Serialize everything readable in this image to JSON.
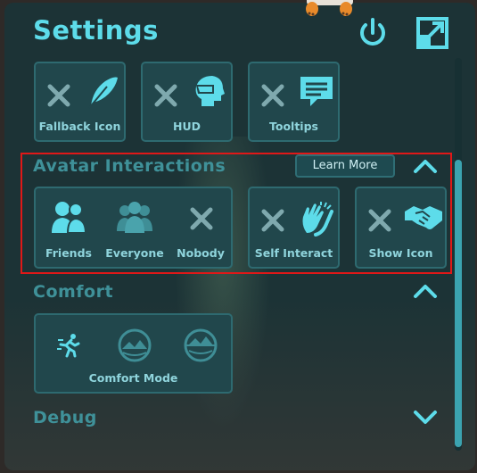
{
  "header": {
    "title": "Settings",
    "power_icon": "power-icon",
    "expand_icon": "expand-window-icon"
  },
  "top_row": {
    "tiles": [
      {
        "label": "Fallback Icon",
        "icon": "feather-icon"
      },
      {
        "label": "HUD",
        "icon": "head-visor-icon"
      },
      {
        "label": "Tooltips",
        "icon": "speech-bubble-icon"
      }
    ]
  },
  "avatar_interactions": {
    "title": "Avatar Interactions",
    "learn_more": "Learn More",
    "group": {
      "options": [
        "Friends",
        "Everyone",
        "Nobody"
      ],
      "selected": "Friends"
    },
    "self_interact": {
      "label": "Self Interact",
      "icon": "clapping-hands-icon"
    },
    "show_icon": {
      "label": "Show Icon",
      "icon": "handshake-icon"
    }
  },
  "comfort": {
    "title": "Comfort",
    "tile_label": "Comfort Mode",
    "options": [
      "running-person-icon",
      "mountain-view-icon",
      "mountain-view-icon"
    ],
    "selected": 0
  },
  "debug": {
    "title": "Debug"
  },
  "colors": {
    "accent": "#5ddcea",
    "panel": "#1c3336",
    "tile": "#21474c",
    "highlight": "#e01818"
  },
  "scrollbar": {
    "position": 0.55
  }
}
